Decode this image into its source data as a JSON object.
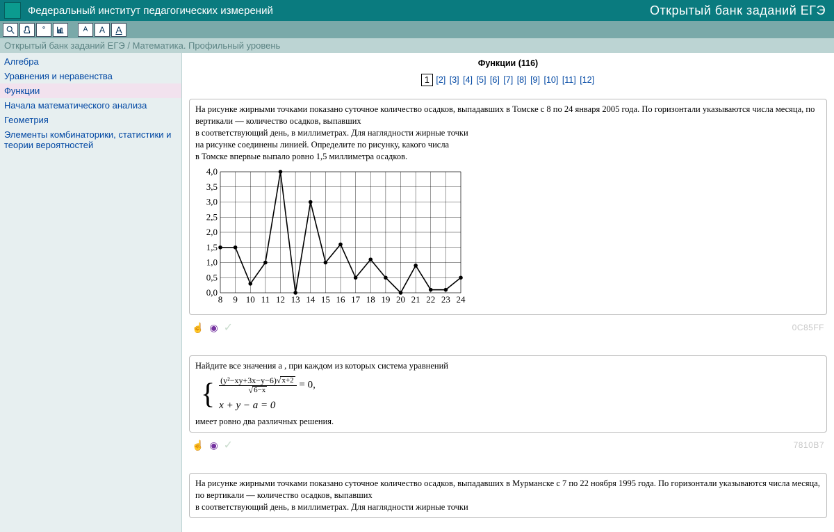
{
  "header": {
    "title": "Федеральный институт педагогических измерений",
    "right": "Открытый банк заданий ЕГЭ"
  },
  "toolbar": {
    "search_icon": "search-icon",
    "hand_icon": "hand-icon",
    "degree_icon": "degree-icon",
    "chart_icon": "chart-icon",
    "font_a1": "A",
    "font_a2": "A",
    "font_a3": "A"
  },
  "breadcrumb": "Открытый банк заданий ЕГЭ / Математика. Профильный уровень",
  "sidebar": {
    "items": [
      {
        "label": "Алгебра",
        "active": false
      },
      {
        "label": "Уравнения и неравенства",
        "active": false
      },
      {
        "label": "Функции",
        "active": true
      },
      {
        "label": "Начала математического анализа",
        "active": false
      },
      {
        "label": "Геометрия",
        "active": false
      },
      {
        "label": "Элементы комбинаторики, статистики и теории вероятностей",
        "active": false
      }
    ]
  },
  "page": {
    "title": "Функции (116)",
    "pages": [
      "1",
      "2",
      "3",
      "4",
      "5",
      "6",
      "7",
      "8",
      "9",
      "10",
      "11",
      "12"
    ],
    "current": "1"
  },
  "tasks": [
    {
      "code": "0C85FF",
      "text_lines": [
        "На рисунке жирными точками показано суточное количество осадков, выпадавших в Томске с 8 по 24 января 2005 года. По горизонтали указываются числа месяца, по вертикали — количество осадков, выпавших",
        "в соответствующий день, в миллиметрах. Для наглядности жирные точки",
        "на рисунке соединены линией. Определите по рисунку, какого числа",
        "в Томске впервые выпало ровно 1,5 миллиметра осадков."
      ]
    },
    {
      "code": "7810B7",
      "intro": "Найдите все значения a , при каждом из которых система уравнений",
      "eq_numer_expr": "(y²−xy+3x−y−6)",
      "eq_numer_sqrt": "x+2",
      "eq_denom_sqrt": "6−x",
      "eq_rhs": " = 0,",
      "eq_row2": "x + y − a = 0",
      "tail": "имеет ровно два различных решения."
    },
    {
      "code": "",
      "text_lines": [
        "На рисунке жирными точками показано суточное количество осадков, выпадавших в Мурманске с 7 по 22 ноября 1995 года. По горизонтали указываются числа месяца, по вертикали — количество осадков, выпавших",
        "в соответствующий день, в миллиметрах. Для наглядности жирные точки"
      ]
    }
  ],
  "chart_data": {
    "type": "line",
    "title": "",
    "xlabel": "",
    "ylabel": "",
    "ylim": [
      0,
      4
    ],
    "y_ticks": [
      "0,0",
      "0,5",
      "1,0",
      "1,5",
      "2,0",
      "2,5",
      "3,0",
      "3,5",
      "4,0"
    ],
    "x": [
      8,
      9,
      10,
      11,
      12,
      13,
      14,
      15,
      16,
      17,
      18,
      19,
      20,
      21,
      22,
      23,
      24
    ],
    "values": [
      1.5,
      1.5,
      0.3,
      1.0,
      4.0,
      0.0,
      3.0,
      1.0,
      1.6,
      0.5,
      1.1,
      0.5,
      0.0,
      0.9,
      0.1,
      0.1,
      0.5
    ]
  }
}
